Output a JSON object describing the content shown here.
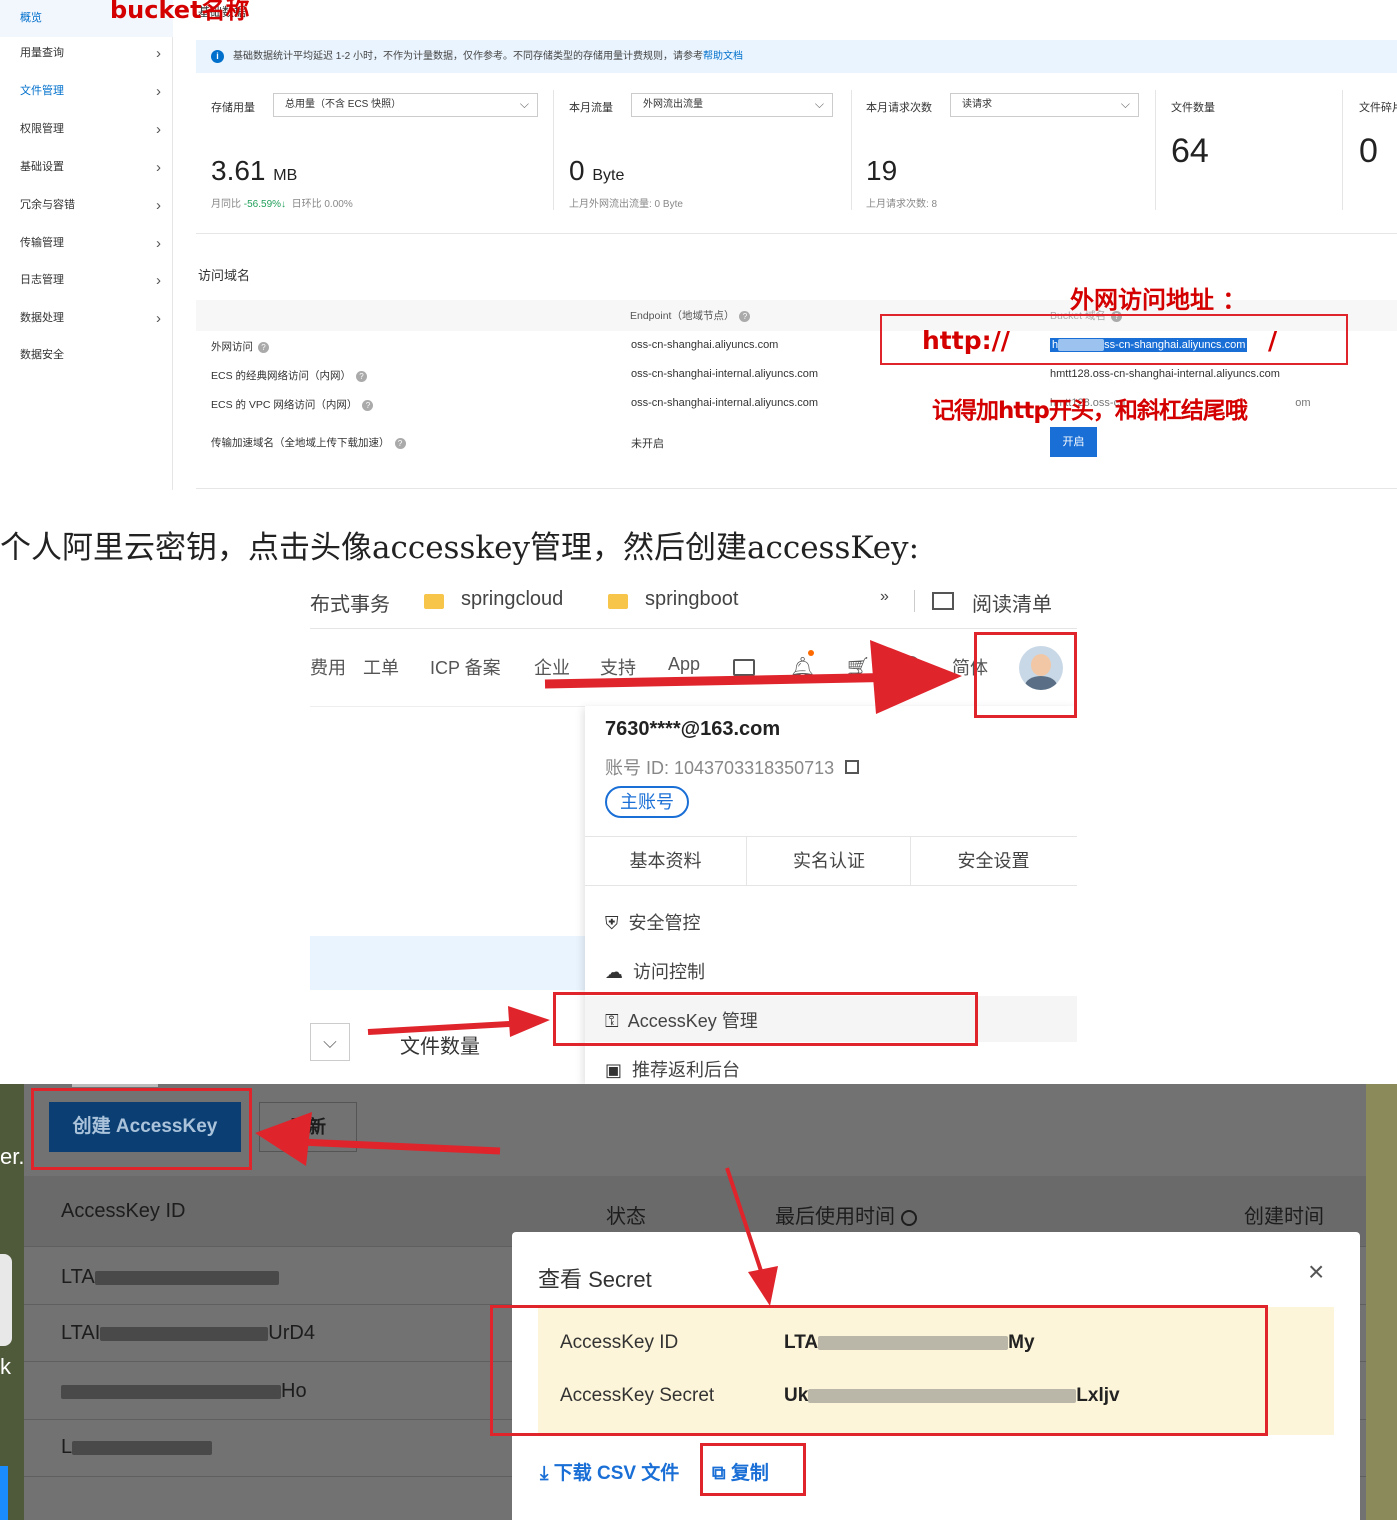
{
  "panel1": {
    "annotation_bucket": "bucket名称",
    "sidebar": {
      "items": [
        {
          "label": "概览",
          "active": true,
          "chevron": false
        },
        {
          "label": "用量查询",
          "chevron": true
        },
        {
          "label": "文件管理",
          "chevron": true,
          "blue": true
        },
        {
          "label": "权限管理",
          "chevron": true
        },
        {
          "label": "基础设置",
          "chevron": true
        },
        {
          "label": "冗余与容错",
          "chevron": true
        },
        {
          "label": "传输管理",
          "chevron": true
        },
        {
          "label": "日志管理",
          "chevron": true
        },
        {
          "label": "数据处理",
          "chevron": true
        },
        {
          "label": "数据安全",
          "chevron": false
        }
      ]
    },
    "section_title": "基础数据",
    "notice": {
      "text": "基础数据统计平均延迟 1-2 小时，不作为计量数据，仅作参考。不同存储类型的存储用量计费规则，请参考",
      "link": "帮助文档"
    },
    "stats": [
      {
        "label": "存储用量",
        "select": "总用量（不含 ECS 快照）",
        "value": "3.61",
        "unit": "MB",
        "sub_a": "月同比",
        "sub_b": "-56.59%↓",
        "sub_c": "日环比 0.00%"
      },
      {
        "label": "本月流量",
        "select": "外网流出流量",
        "value": "0",
        "unit": "Byte",
        "sub": "上月外网流出流量:  0 Byte"
      },
      {
        "label": "本月请求次数",
        "select": "读请求",
        "value": "19",
        "unit": "",
        "sub": "上月请求次数:   8"
      },
      {
        "label": "文件数量",
        "value": "64"
      },
      {
        "label": "文件碎片",
        "value": "0"
      }
    ],
    "domain": {
      "title": "访问域名",
      "col_endpoint": "Endpoint（地域节点）",
      "col_bucket": "Bucket 域名",
      "rows": [
        {
          "label": "外网访问",
          "endpoint": "oss-cn-shanghai.aliyuncs.com",
          "bucket_prefix": "h",
          "bucket": "ss-cn-shanghai.aliyuncs.com"
        },
        {
          "label": "ECS 的经典网络访问（内网）",
          "endpoint": "oss-cn-shanghai-internal.aliyuncs.com",
          "bucket": "hmtt128.oss-cn-shanghai-internal.aliyuncs.com"
        },
        {
          "label": "ECS 的 VPC 网络访问（内网）",
          "endpoint": "oss-cn-shanghai-internal.aliyuncs.com",
          "bucket_prefix": "hmtt128.oss-cn",
          "bucket_suffix": "om"
        },
        {
          "label": "传输加速域名（全地域上传下载加速）",
          "endpoint": "未开启",
          "button": "开启"
        }
      ]
    },
    "annotation_external": "外网访问地址 ：",
    "annotation_http": "http://",
    "annotation_slash": "/",
    "annotation_tip": "记得加http开头，和斜杠结尾哦"
  },
  "text_line": "个人阿里云密钥，点击头像accesskey管理，然后创建accessKey:",
  "panel2": {
    "bookmarks": [
      "布式事务",
      "springcloud",
      "springboot",
      "»",
      "阅读清单"
    ],
    "nav": [
      "费用",
      "工单",
      "ICP 备案",
      "企业",
      "支持",
      "App",
      "简体"
    ],
    "email": "7630****@163.com",
    "account_id": "账号 ID:  1043703318350713",
    "badge": "主账号",
    "tabs": [
      "基本资料",
      "实名认证",
      "安全设置"
    ],
    "menu": [
      "安全管控",
      "访问控制",
      "AccessKey 管理",
      "推荐返利后台"
    ],
    "left_text": "文件数量"
  },
  "panel3": {
    "create_button": "创建 AccessKey",
    "refresh_button": "刷新",
    "columns": [
      "AccessKey ID",
      "状态",
      "最后使用时间",
      "创建时间"
    ],
    "rows": [
      "LTA",
      "LTAI",
      "UrD4",
      "Ho",
      "L"
    ],
    "left_edge": [
      "er..",
      "k"
    ],
    "modal": {
      "title": "查看 Secret",
      "id_label": "AccessKey ID",
      "id_value_a": "LTA",
      "id_value_b": "My",
      "secret_label": "AccessKey Secret",
      "secret_value_a": "Uk",
      "secret_value_b": "Lxljv",
      "download": "下载 CSV 文件",
      "copy": "复制"
    }
  }
}
